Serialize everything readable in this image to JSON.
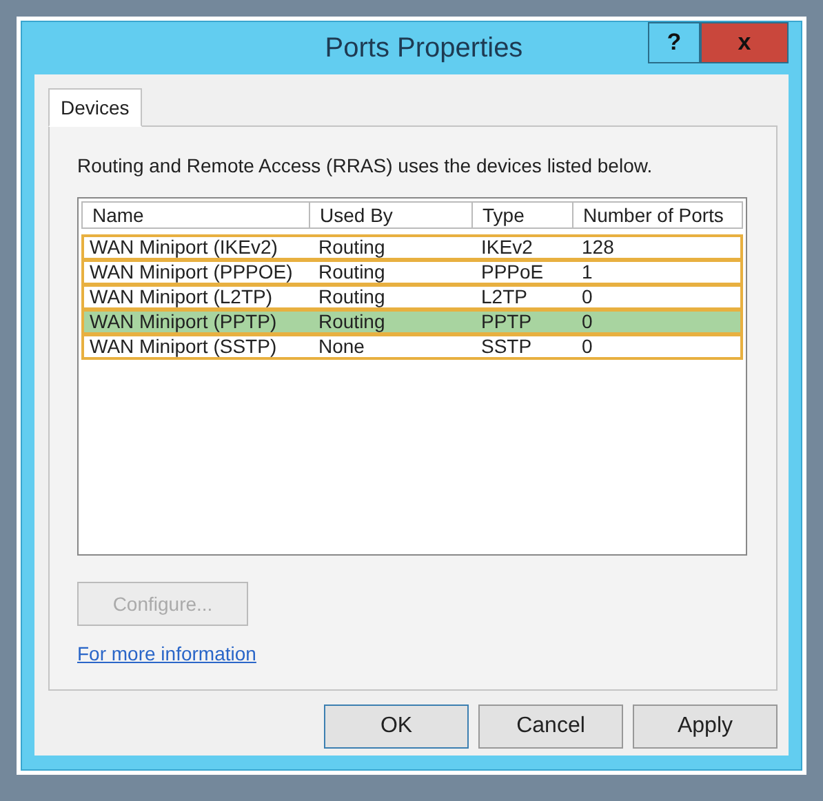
{
  "window": {
    "title": "Ports Properties",
    "help_button": "?",
    "close_button": "x"
  },
  "tabs": [
    {
      "label": "Devices",
      "selected": true
    }
  ],
  "description": "Routing and Remote Access (RRAS) uses the devices listed below.",
  "table": {
    "columns": [
      "Name",
      "Used By",
      "Type",
      "Number of Ports"
    ],
    "rows": [
      {
        "cells": [
          "WAN Miniport (IKEv2)",
          "Routing",
          "IKEv2",
          "128"
        ],
        "selected": false
      },
      {
        "cells": [
          "WAN Miniport (PPPOE)",
          "Routing",
          "PPPoE",
          "1"
        ],
        "selected": false
      },
      {
        "cells": [
          "WAN Miniport (L2TP)",
          "Routing",
          "L2TP",
          "0"
        ],
        "selected": false
      },
      {
        "cells": [
          "WAN Miniport (PPTP)",
          "Routing",
          "PPTP",
          "0"
        ],
        "selected": true
      },
      {
        "cells": [
          "WAN Miniport (SSTP)",
          "None",
          "SSTP",
          "0"
        ],
        "selected": false
      }
    ]
  },
  "configure_button": {
    "label": "Configure...",
    "disabled": true
  },
  "link": "For more information",
  "buttons": [
    {
      "label": "OK",
      "default": true
    },
    {
      "label": "Cancel",
      "default": false
    },
    {
      "label": "Apply",
      "default": false
    }
  ]
}
